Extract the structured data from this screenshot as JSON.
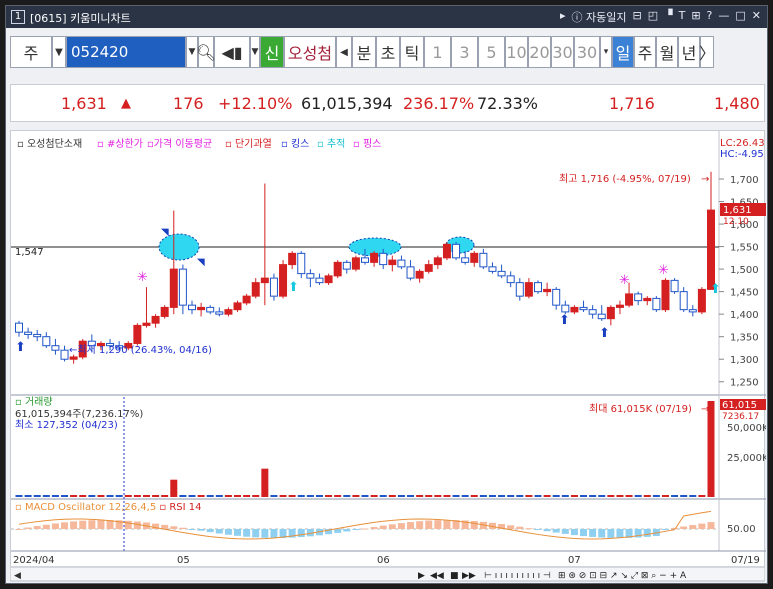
{
  "window": {
    "number": "1",
    "title": "[0615] 키움미니차트",
    "tools": [
      "자동일지",
      "⊟",
      "◰",
      "▝",
      "T",
      "⊞",
      "?",
      "—",
      "□",
      "✕"
    ]
  },
  "toolbar": {
    "market": "주",
    "code": "052420",
    "sin": "신",
    "name": "오성첨",
    "periods": [
      "분",
      "초",
      "틱"
    ],
    "nums": [
      "1",
      "3",
      "5",
      "10",
      "20",
      "30"
    ],
    "sel": "30",
    "views": [
      "일",
      "주",
      "월",
      "년"
    ]
  },
  "quote": {
    "price": "1,631",
    "arrow": "▲",
    "change": "176",
    "pct": "+12.10%",
    "volume": "61,015,394",
    "volpct": "236.17%",
    "ratio": "72.33%",
    "high": "1,716",
    "low": "1,480"
  },
  "legend": {
    "items": [
      "오성첨단소재",
      "#상한가",
      "가격 이동평균",
      "단기과열",
      "킹스",
      "추적",
      "핑스"
    ],
    "lc": "LC:26.43",
    "hc": "HC:-4.95"
  },
  "price": {
    "current_label": "1,631",
    "tag2": "12.10",
    "line_label": "1,547",
    "hi_text": "최고 1,716 (-4.95%, 07/19)",
    "lo_text": "최저 1,290 (26.43%, 04/16)",
    "ticks": [
      "1,700",
      "1,650",
      "1,600",
      "1,550",
      "1,500",
      "1,450",
      "1,400",
      "1,350",
      "1,300",
      "1,250"
    ]
  },
  "vol": {
    "title": "거래량",
    "line1": "61,015,394주(7,236.17%)",
    "line2": "최소 127,352 (04/23)",
    "max_text": "최대 61,015K (07/19)",
    "tag": "61,015",
    "tag2": "7236.17",
    "ticks": [
      "50,000K",
      "25,000K"
    ]
  },
  "macd": {
    "title": "MACD Oscillator 12,26,4,5",
    "rsi": "RSI 14",
    "tick": "50.00"
  },
  "dates": [
    "2024/04",
    "05",
    "06",
    "07",
    "07/19"
  ],
  "chart_data": {
    "type": "candlestick",
    "dates_x": [
      "2024/04",
      "05",
      "06",
      "07",
      "07/19"
    ],
    "ohlc": [
      [
        1380,
        1385,
        1350,
        1360
      ],
      [
        1360,
        1370,
        1345,
        1355
      ],
      [
        1355,
        1365,
        1340,
        1350
      ],
      [
        1350,
        1360,
        1325,
        1330
      ],
      [
        1330,
        1345,
        1310,
        1320
      ],
      [
        1320,
        1330,
        1295,
        1300
      ],
      [
        1300,
        1310,
        1290,
        1305
      ],
      [
        1305,
        1345,
        1300,
        1340
      ],
      [
        1340,
        1355,
        1315,
        1330
      ],
      [
        1330,
        1340,
        1320,
        1335
      ],
      [
        1335,
        1345,
        1320,
        1330
      ],
      [
        1330,
        1340,
        1320,
        1325
      ],
      [
        1325,
        1340,
        1320,
        1335
      ],
      [
        1335,
        1380,
        1330,
        1375
      ],
      [
        1375,
        1460,
        1370,
        1380
      ],
      [
        1380,
        1400,
        1370,
        1395
      ],
      [
        1395,
        1420,
        1390,
        1415
      ],
      [
        1415,
        1630,
        1400,
        1500
      ],
      [
        1500,
        1510,
        1400,
        1420
      ],
      [
        1420,
        1430,
        1400,
        1410
      ],
      [
        1410,
        1425,
        1395,
        1415
      ],
      [
        1415,
        1420,
        1400,
        1405
      ],
      [
        1405,
        1415,
        1395,
        1400
      ],
      [
        1400,
        1415,
        1395,
        1410
      ],
      [
        1410,
        1430,
        1405,
        1425
      ],
      [
        1425,
        1445,
        1420,
        1440
      ],
      [
        1440,
        1480,
        1435,
        1470
      ],
      [
        1470,
        1690,
        1420,
        1480
      ],
      [
        1480,
        1490,
        1430,
        1440
      ],
      [
        1440,
        1520,
        1435,
        1510
      ],
      [
        1510,
        1540,
        1500,
        1535
      ],
      [
        1535,
        1540,
        1480,
        1490
      ],
      [
        1490,
        1500,
        1460,
        1480
      ],
      [
        1480,
        1490,
        1465,
        1470
      ],
      [
        1470,
        1490,
        1465,
        1485
      ],
      [
        1485,
        1520,
        1480,
        1515
      ],
      [
        1515,
        1520,
        1490,
        1500
      ],
      [
        1500,
        1530,
        1495,
        1525
      ],
      [
        1525,
        1545,
        1510,
        1515
      ],
      [
        1515,
        1540,
        1505,
        1535
      ],
      [
        1535,
        1545,
        1500,
        1510
      ],
      [
        1510,
        1530,
        1495,
        1520
      ],
      [
        1520,
        1530,
        1500,
        1505
      ],
      [
        1505,
        1520,
        1475,
        1480
      ],
      [
        1480,
        1500,
        1470,
        1495
      ],
      [
        1495,
        1520,
        1490,
        1510
      ],
      [
        1510,
        1530,
        1500,
        1525
      ],
      [
        1525,
        1560,
        1520,
        1555
      ],
      [
        1555,
        1560,
        1520,
        1525
      ],
      [
        1525,
        1540,
        1510,
        1515
      ],
      [
        1515,
        1540,
        1505,
        1535
      ],
      [
        1535,
        1545,
        1500,
        1505
      ],
      [
        1505,
        1515,
        1490,
        1495
      ],
      [
        1495,
        1510,
        1480,
        1485
      ],
      [
        1485,
        1495,
        1460,
        1470
      ],
      [
        1470,
        1480,
        1430,
        1440
      ],
      [
        1440,
        1480,
        1435,
        1470
      ],
      [
        1470,
        1475,
        1445,
        1450
      ],
      [
        1450,
        1470,
        1440,
        1455
      ],
      [
        1455,
        1460,
        1410,
        1420
      ],
      [
        1420,
        1430,
        1400,
        1405
      ],
      [
        1405,
        1420,
        1400,
        1415
      ],
      [
        1415,
        1430,
        1405,
        1410
      ],
      [
        1410,
        1420,
        1390,
        1400
      ],
      [
        1400,
        1420,
        1385,
        1390
      ],
      [
        1390,
        1420,
        1375,
        1415
      ],
      [
        1415,
        1430,
        1400,
        1420
      ],
      [
        1420,
        1470,
        1415,
        1445
      ],
      [
        1445,
        1450,
        1420,
        1430
      ],
      [
        1430,
        1440,
        1420,
        1435
      ],
      [
        1435,
        1440,
        1405,
        1410
      ],
      [
        1410,
        1480,
        1405,
        1475
      ],
      [
        1475,
        1480,
        1445,
        1450
      ],
      [
        1450,
        1460,
        1405,
        1410
      ],
      [
        1410,
        1420,
        1395,
        1405
      ],
      [
        1405,
        1460,
        1400,
        1455
      ],
      [
        1455,
        1716,
        1480,
        1631
      ]
    ],
    "volumes": [
      1,
      1,
      1,
      1,
      1,
      1,
      1,
      1,
      1,
      1,
      1,
      1,
      1,
      1,
      1,
      1,
      1,
      11,
      1,
      1,
      1,
      1,
      1,
      1,
      1,
      1,
      1,
      18,
      1,
      1,
      1,
      1,
      1,
      1,
      1,
      1,
      1,
      1,
      1,
      1,
      1,
      1,
      1,
      1,
      1,
      1,
      1,
      1,
      1,
      1,
      1,
      1,
      1,
      1,
      1,
      1,
      1,
      1,
      1,
      1,
      1,
      1,
      1,
      1,
      1,
      1,
      1,
      1,
      1,
      1,
      1,
      1,
      1,
      1,
      1,
      1,
      61
    ],
    "ylim": [
      1225,
      1740
    ]
  }
}
